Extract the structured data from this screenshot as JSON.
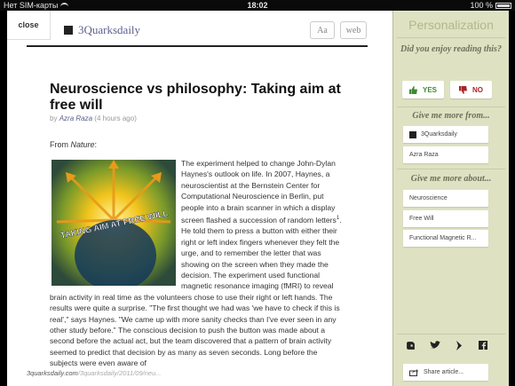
{
  "status_bar": {
    "carrier": "Нет SIM-карты",
    "time": "18:02",
    "battery": "100 %"
  },
  "article": {
    "close_label": "close",
    "site_name": "3Quarksdaily",
    "font_button_label": "Aa",
    "web_button_label": "web",
    "title": "Neuroscience vs philosophy: Taking aim at free will",
    "byline_prefix": "by",
    "author": "Azra Raza",
    "age": "(4 hours ago)",
    "from_prefix": "From",
    "from_source": "Nature",
    "figure_caption": "TAKING AIM AT FREE WILL",
    "body": "The experiment helped to change John-Dylan Haynes's outlook on life. In 2007, Haynes, a neuroscientist at the Bernstein Center for Computational Neuroscience in Berlin, put people into a brain scanner in which a display screen flashed a succession of random letters",
    "footnote": "1",
    "body_cont": ". He told them to press a button with either their right or left index fingers whenever they felt the urge, and to remember the letter that was showing on the screen when they made the decision. The experiment used functional magnetic resonance imaging (fMRI) to reveal brain activity in real time as the volunteers chose to use their right or left hands. The results were quite a surprise. \"The first thought we had was 'we have to check if this is real',\" says Haynes. \"We came up with more sanity checks than I've ever seen in any other study before.\" The conscious decision to push the button was made about a second before the actual act, but the team discovered that a pattern of brain activity seemed to predict that decision by as many as seven seconds. Long before the subjects were even aware of",
    "url_host": "3quarksdaily.com",
    "url_path": "/3quarksdaily/2011/09/neu..."
  },
  "sidebar": {
    "title": "Personalization",
    "question": "Did you enjoy reading this?",
    "yes_label": "YES",
    "no_label": "NO",
    "more_from_heading": "Give me more from...",
    "more_from": [
      "3Quarksdaily",
      "Azra Raza"
    ],
    "more_about_heading": "Give me more about...",
    "more_about": [
      "Neuroscience",
      "Free Will",
      "Functional Magnetic R..."
    ],
    "share_label": "Share article..."
  },
  "colors": {
    "sidebar_bg": "#dfe2c2",
    "yes": "#3c8a2e",
    "no": "#a8252a",
    "link": "#5b5f8c"
  },
  "icons": [
    "wifi-icon",
    "battery-icon",
    "site-icon",
    "thumbs-up-icon",
    "thumbs-down-icon",
    "evernote-icon",
    "twitter-icon",
    "instapaper-icon",
    "facebook-icon",
    "share-icon"
  ]
}
